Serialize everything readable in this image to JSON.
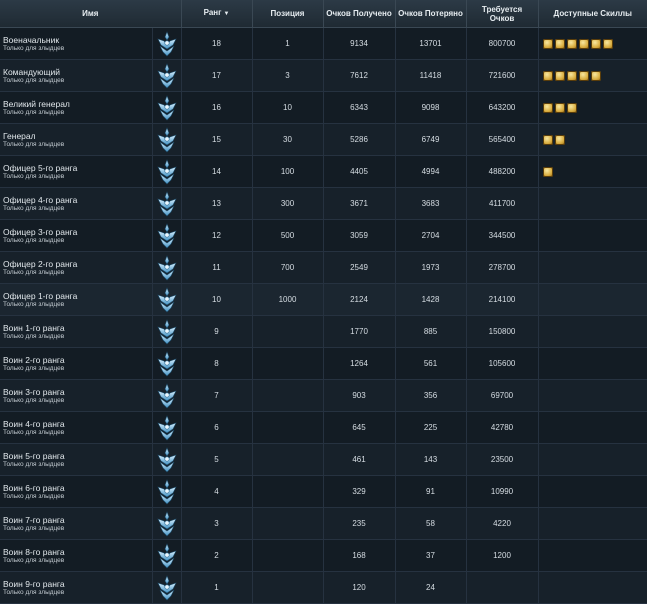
{
  "headers": {
    "name": "Имя",
    "rank": "Ранг",
    "position": "Позиция",
    "points_earned": "Очков Получено",
    "points_lost": "Очков Потеряно",
    "points_required": "Требуется Очков",
    "skills": "Доступные Скиллы"
  },
  "sort_icon": "sort-desc-icon",
  "rows": [
    {
      "name": "Военачальник",
      "note": "Только для злыдцев",
      "rank": "18",
      "position": "1",
      "earned": "9134",
      "lost": "13701",
      "required": "800700",
      "skills": 6
    },
    {
      "name": "Командующий",
      "note": "Только для злыдцев",
      "rank": "17",
      "position": "3",
      "earned": "7612",
      "lost": "11418",
      "required": "721600",
      "skills": 5
    },
    {
      "name": "Великий генерал",
      "note": "Только для злыдцев",
      "rank": "16",
      "position": "10",
      "earned": "6343",
      "lost": "9098",
      "required": "643200",
      "skills": 3
    },
    {
      "name": "Генерал",
      "note": "Только для злыдцев",
      "rank": "15",
      "position": "30",
      "earned": "5286",
      "lost": "6749",
      "required": "565400",
      "skills": 2
    },
    {
      "name": "Офицер 5-го ранга",
      "note": "Только для злыдцев",
      "rank": "14",
      "position": "100",
      "earned": "4405",
      "lost": "4994",
      "required": "488200",
      "skills": 1
    },
    {
      "name": "Офицер 4-го ранга",
      "note": "Только для злыдцев",
      "rank": "13",
      "position": "300",
      "earned": "3671",
      "lost": "3683",
      "required": "411700",
      "skills": 0
    },
    {
      "name": "Офицер 3-го ранга",
      "note": "Только для злыдцев",
      "rank": "12",
      "position": "500",
      "earned": "3059",
      "lost": "2704",
      "required": "344500",
      "skills": 0
    },
    {
      "name": "Офицер 2-го ранга",
      "note": "Только для злыдцев",
      "rank": "11",
      "position": "700",
      "earned": "2549",
      "lost": "1973",
      "required": "278700",
      "skills": 0
    },
    {
      "name": "Офицер 1-го ранга",
      "note": "Только для злыдцев",
      "rank": "10",
      "position": "1000",
      "earned": "2124",
      "lost": "1428",
      "required": "214100",
      "skills": 0
    },
    {
      "name": "Воин 1-го ранга",
      "note": "Только для злыдцев",
      "rank": "9",
      "position": "",
      "earned": "1770",
      "lost": "885",
      "required": "150800",
      "skills": 0
    },
    {
      "name": "Воин 2-го ранга",
      "note": "Только для злыдцев",
      "rank": "8",
      "position": "",
      "earned": "1264",
      "lost": "561",
      "required": "105600",
      "skills": 0
    },
    {
      "name": "Воин 3-го ранга",
      "note": "Только для злыдцев",
      "rank": "7",
      "position": "",
      "earned": "903",
      "lost": "356",
      "required": "69700",
      "skills": 0
    },
    {
      "name": "Воин 4-го ранга",
      "note": "Только для злыдцев",
      "rank": "6",
      "position": "",
      "earned": "645",
      "lost": "225",
      "required": "42780",
      "skills": 0
    },
    {
      "name": "Воин 5-го ранга",
      "note": "Только для злыдцев",
      "rank": "5",
      "position": "",
      "earned": "461",
      "lost": "143",
      "required": "23500",
      "skills": 0
    },
    {
      "name": "Воин 6-го ранга",
      "note": "Только для злыдцев",
      "rank": "4",
      "position": "",
      "earned": "329",
      "lost": "91",
      "required": "10990",
      "skills": 0
    },
    {
      "name": "Воин 7-го ранга",
      "note": "Только для злыдцев",
      "rank": "3",
      "position": "",
      "earned": "235",
      "lost": "58",
      "required": "4220",
      "skills": 0
    },
    {
      "name": "Воин 8-го ранга",
      "note": "Только для злыдцев",
      "rank": "2",
      "position": "",
      "earned": "168",
      "lost": "37",
      "required": "1200",
      "skills": 0
    },
    {
      "name": "Воин 9-го ранга",
      "note": "Только для злыдцев",
      "rank": "1",
      "position": "",
      "earned": "120",
      "lost": "24",
      "required": "",
      "skills": 0
    }
  ],
  "highlighted_row_index": 8,
  "rank_emblem_icon": "rank-emblem-icon",
  "skill_icon": "skill-icon"
}
